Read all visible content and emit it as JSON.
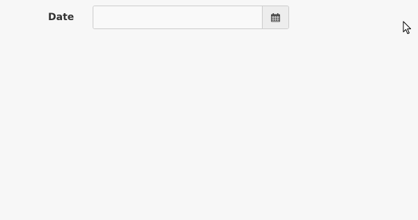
{
  "form": {
    "date_label": "Date",
    "date_value": "",
    "date_placeholder": ""
  },
  "icons": {
    "calendar": "calendar-icon",
    "cursor": "mouse-pointer-icon"
  },
  "colors": {
    "background": "#f7f7f7",
    "input_border": "#cccccc",
    "addon_background": "#ededed",
    "icon": "#444444",
    "label_text": "#333333"
  }
}
